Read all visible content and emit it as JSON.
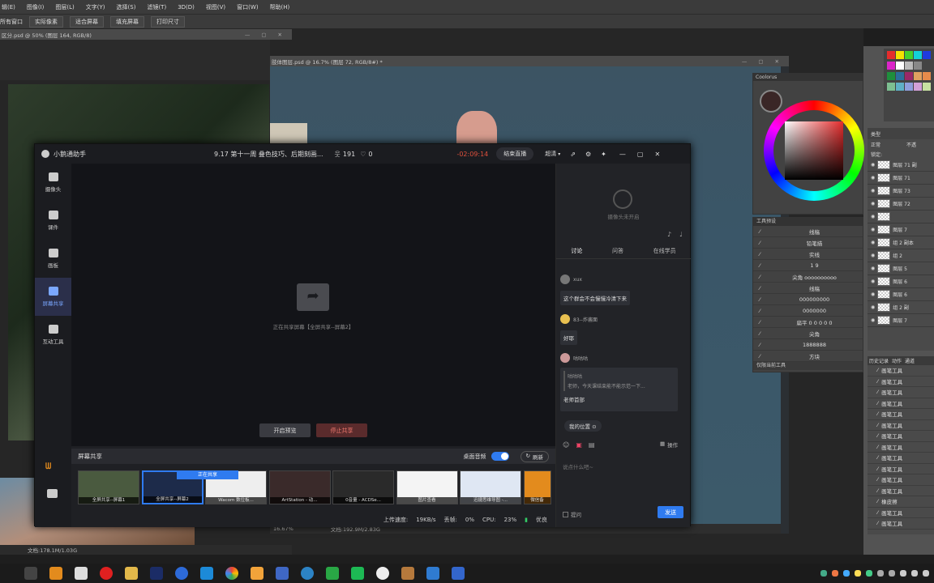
{
  "menu": [
    "辑(E)",
    "图像(I)",
    "图层(L)",
    "文字(Y)",
    "选择(S)",
    "滤镜(T)",
    "3D(D)",
    "视图(V)",
    "窗口(W)",
    "帮助(H)"
  ],
  "options": {
    "all_windows": "所有窗口",
    "actual_pixels": "实际像素",
    "fit_screen": "适合屏幕",
    "fill_screen": "填充屏幕",
    "print_size": "打印尺寸"
  },
  "doc1_tab": "区分.psd @ 50% (图层 164, RGB/8)",
  "doc2_tab": "肢体图层.psd @ 16.7% (图层 72, RGB/8#) *",
  "doc2_zoom": "16.67%",
  "doc2_info": "文档:192.9M/2.83G",
  "doc1_info": "文档:178.1M/1.03G",
  "color_panel_title": "Coolorus",
  "tool_preset": {
    "title": "工具预设",
    "items": [
      "线稿",
      "铅笔描",
      "实线",
      "1  9",
      "尖角 oooooooooo",
      "线稿",
      "000000000",
      "0000000",
      "扁平 0 0 0 0 0",
      "尖角",
      "1888888",
      "方块"
    ],
    "footer": "仅限当前工具"
  },
  "layers_panel": {
    "kind_label": "类型",
    "mode": "正常",
    "lock_label": "锁定:",
    "opacity_label": "不透",
    "rows": [
      "图层 71 副",
      "图层 71",
      "图层 73",
      "图层 72",
      "",
      "图层 7",
      "组 2 副本",
      "组 2",
      "图层 5",
      "图层 6",
      "图层 6",
      "组 2 副",
      "图层 7"
    ]
  },
  "history": {
    "tabs": [
      "历史记录",
      "动作",
      "通道"
    ],
    "items": [
      "画笔工具",
      "画笔工具",
      "画笔工具",
      "画笔工具",
      "画笔工具",
      "画笔工具",
      "画笔工具",
      "画笔工具",
      "画笔工具",
      "画笔工具",
      "画笔工具",
      "画笔工具",
      "橡皮擦",
      "画笔工具",
      "画笔工具"
    ]
  },
  "app": {
    "name": "小鹅通助手",
    "course_title": "9.17 第十一周 叠色技巧、后期刻画...",
    "viewers": "191",
    "likes": "0",
    "timer": "-02:09:14",
    "end_live": "结束直播",
    "quality": "超清",
    "sidebar": [
      {
        "label": "摄像头",
        "icon": "camera-icon"
      },
      {
        "label": "课件",
        "icon": "folder-icon"
      },
      {
        "label": "画板",
        "icon": "palette-icon"
      },
      {
        "label": "屏幕共享",
        "icon": "screen-share-icon"
      },
      {
        "label": "互动工具",
        "icon": "toolbox-icon"
      }
    ],
    "sharing_text": "正在共享屏幕【全屏共享--屏幕2】",
    "open_preview": "开启预览",
    "stop_share": "停止共享",
    "screen_share_title": "屏幕共享",
    "desktop_audio": "桌面音频",
    "refresh": "刷新",
    "thumbs": [
      "全屏共享--屏幕1",
      "全屏共享--屏幕2",
      "Wacom 数位板...",
      "ArtStation - 动...",
      "0音量 - ACDSe...",
      "图片查看",
      "迅捷思维导图 -...",
      "微信备"
    ],
    "sharing_badge": "正在共享",
    "status": {
      "upload_label": "上传速度:",
      "upload": "19KB/s",
      "loss_label": "丢帧:",
      "loss": "0%",
      "cpu_label": "CPU:",
      "cpu": "23%",
      "quality": "优良"
    },
    "chat": {
      "camera_off": "摄像头未开启",
      "tabs": [
        "讨论",
        "问答",
        "在线学员"
      ],
      "user1": "xux",
      "msg1": "这个群会不会慢慢冷清下来",
      "user2": "83--炸酱面",
      "msg2": "好耶",
      "user3": "咕咕咕",
      "quote_name": "咕咕咕",
      "quote": "老师，今天课结束能不能示范一下...",
      "msg3": "老师首部",
      "my_position": "我的位置",
      "operate": "操作",
      "placeholder": "说点什么吧~",
      "ask": "提问",
      "send": "发送"
    }
  }
}
